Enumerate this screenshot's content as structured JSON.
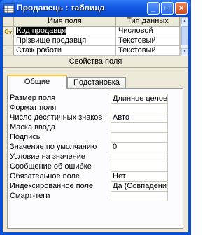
{
  "window": {
    "title": "Продавець : таблица",
    "buttons": {
      "minimize": "_",
      "maximize": "□",
      "close": "×"
    }
  },
  "grid": {
    "headers": {
      "field_name": "Имя поля",
      "data_type": "Тип данных"
    },
    "rows": [
      {
        "name": "Код продавця",
        "type": "Числовой",
        "is_key": true,
        "active": true
      },
      {
        "name": "Прізвище продавця",
        "type": "Текстовый",
        "is_key": false,
        "active": false
      },
      {
        "name": "Стаж роботи",
        "type": "Текстовый",
        "is_key": false,
        "active": false
      }
    ]
  },
  "properties": {
    "label": "Свойства поля",
    "tabs": {
      "general": "Общие",
      "lookup": "Подстановка"
    },
    "rows": [
      {
        "label": "Размер поля",
        "value": "Длинное целое"
      },
      {
        "label": "Формат поля",
        "value": ""
      },
      {
        "label": "Число десятичных знаков",
        "value": "Авто"
      },
      {
        "label": "Маска ввода",
        "value": ""
      },
      {
        "label": "Подпись",
        "value": ""
      },
      {
        "label": "Значение по умолчанию",
        "value": "0"
      },
      {
        "label": "Условие на значение",
        "value": ""
      },
      {
        "label": "Сообщение об ошибке",
        "value": ""
      },
      {
        "label": "Обязательное поле",
        "value": "Нет"
      },
      {
        "label": "Индексированное поле",
        "value": "Да (Совпадения не допускаются)"
      },
      {
        "label": "Смарт-теги",
        "value": ""
      }
    ]
  },
  "colors": {
    "titlebar": "#0a4fd8",
    "client": "#ece9d8",
    "tab_highlight": "#ffc83c"
  },
  "icons": {
    "title": "table-icon",
    "key": "primary-key-icon"
  }
}
